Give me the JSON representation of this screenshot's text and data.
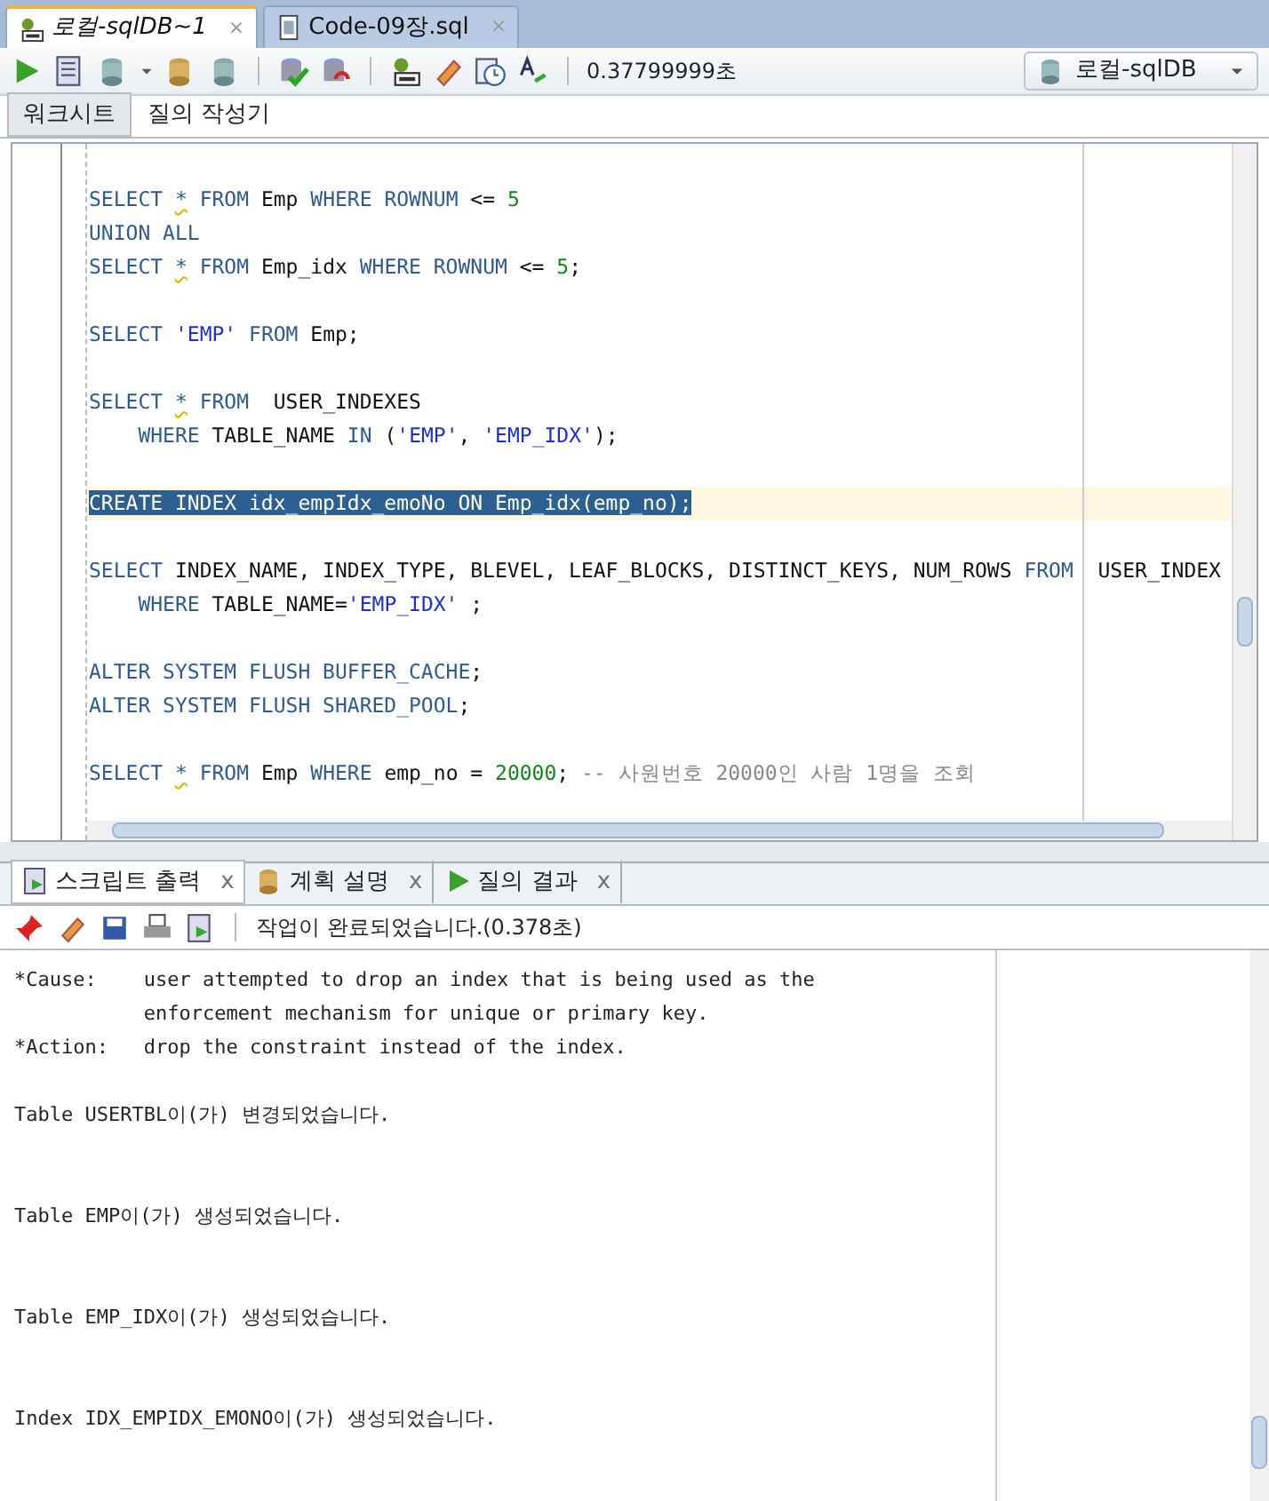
{
  "file_tabs": [
    {
      "label": "로컬-sqlDB~1",
      "close": "×",
      "selected": true
    },
    {
      "label": "Code-09장.sql",
      "close": "×",
      "selected": false
    }
  ],
  "toolbar": {
    "elapsed": "0.37799999초",
    "connection": "로컬-sqlDB"
  },
  "sub_tabs": [
    {
      "label": "워크시트",
      "selected": true
    },
    {
      "label": "질의 작성기",
      "selected": false
    }
  ],
  "editor_lines": [
    {
      "kind": "code",
      "selected": false,
      "tokens": [
        {
          "kind": "kw",
          "s": "SELECT "
        },
        {
          "kind": "warn",
          "s": "*"
        },
        {
          "kind": "kw",
          "s": " FROM "
        },
        {
          "kind": "id",
          "s": "Emp "
        },
        {
          "kind": "kw",
          "s": "WHERE ROWNUM "
        },
        {
          "kind": "id",
          "s": "<= "
        },
        {
          "kind": "num",
          "s": "5"
        }
      ]
    },
    {
      "kind": "code",
      "selected": false,
      "tokens": [
        {
          "kind": "kw",
          "s": "UNION ALL"
        }
      ]
    },
    {
      "kind": "code",
      "selected": false,
      "tokens": [
        {
          "kind": "kw",
          "s": "SELECT "
        },
        {
          "kind": "warn",
          "s": "*"
        },
        {
          "kind": "kw",
          "s": " FROM "
        },
        {
          "kind": "id",
          "s": "Emp_idx "
        },
        {
          "kind": "kw",
          "s": "WHERE ROWNUM "
        },
        {
          "kind": "id",
          "s": "<= "
        },
        {
          "kind": "num",
          "s": "5"
        },
        {
          "kind": "id",
          "s": ";"
        }
      ]
    },
    {
      "kind": "blank"
    },
    {
      "kind": "code",
      "selected": false,
      "tokens": [
        {
          "kind": "kw",
          "s": "SELECT "
        },
        {
          "kind": "str",
          "s": "'EMP'"
        },
        {
          "kind": "kw",
          "s": " FROM "
        },
        {
          "kind": "id",
          "s": "Emp;"
        }
      ]
    },
    {
      "kind": "blank"
    },
    {
      "kind": "code",
      "selected": false,
      "tokens": [
        {
          "kind": "kw",
          "s": "SELECT "
        },
        {
          "kind": "warn",
          "s": "*"
        },
        {
          "kind": "kw",
          "s": " FROM  "
        },
        {
          "kind": "id",
          "s": "USER_INDEXES"
        }
      ]
    },
    {
      "kind": "code",
      "selected": false,
      "tokens": [
        {
          "kind": "kw",
          "s": "    WHERE "
        },
        {
          "kind": "id",
          "s": "TABLE_NAME "
        },
        {
          "kind": "kw",
          "s": "IN "
        },
        {
          "kind": "id",
          "s": "("
        },
        {
          "kind": "str",
          "s": "'EMP'"
        },
        {
          "kind": "id",
          "s": ", "
        },
        {
          "kind": "str",
          "s": "'EMP_IDX'"
        },
        {
          "kind": "id",
          "s": ");"
        }
      ]
    },
    {
      "kind": "blank"
    },
    {
      "kind": "code",
      "selected": true,
      "tokens": [
        {
          "s": "CREATE INDEX idx_empIdx_emoNo ON Emp_idx(emp_no);"
        }
      ]
    },
    {
      "kind": "blank"
    },
    {
      "kind": "code",
      "selected": false,
      "tokens": [
        {
          "kind": "kw",
          "s": "SELECT "
        },
        {
          "kind": "id",
          "s": "INDEX_NAME, INDEX_TYPE, BLEVEL, LEAF_BLOCKS, DISTINCT_KEYS, NUM_ROWS "
        },
        {
          "kind": "kw",
          "s": "FROM  "
        },
        {
          "kind": "id",
          "s": "USER_INDEX"
        }
      ]
    },
    {
      "kind": "code",
      "selected": false,
      "tokens": [
        {
          "kind": "kw",
          "s": "    WHERE "
        },
        {
          "kind": "id",
          "s": "TABLE_NAME="
        },
        {
          "kind": "str",
          "s": "'EMP_IDX'"
        },
        {
          "kind": "id",
          "s": " ;"
        }
      ]
    },
    {
      "kind": "blank"
    },
    {
      "kind": "code",
      "selected": false,
      "tokens": [
        {
          "kind": "kw",
          "s": "ALTER SYSTEM FLUSH BUFFER_CACHE"
        },
        {
          "kind": "id",
          "s": ";"
        }
      ]
    },
    {
      "kind": "code",
      "selected": false,
      "tokens": [
        {
          "kind": "kw",
          "s": "ALTER SYSTEM FLUSH SHARED_POOL"
        },
        {
          "kind": "id",
          "s": ";"
        }
      ]
    },
    {
      "kind": "blank"
    },
    {
      "kind": "code",
      "selected": false,
      "tokens": [
        {
          "kind": "kw",
          "s": "SELECT "
        },
        {
          "kind": "warn",
          "s": "*"
        },
        {
          "kind": "kw",
          "s": " FROM "
        },
        {
          "kind": "id",
          "s": "Emp "
        },
        {
          "kind": "kw",
          "s": "WHERE "
        },
        {
          "kind": "id",
          "s": "emp_no = "
        },
        {
          "kind": "num",
          "s": "20000"
        },
        {
          "kind": "id",
          "s": "; "
        },
        {
          "kind": "cmt",
          "s": "-- 사원번호 20000인 사람 1명을 조회"
        }
      ]
    }
  ],
  "output_tabs": [
    {
      "label": "스크립트 출력",
      "close": "x",
      "selected": true
    },
    {
      "label": "계획 설명",
      "close": "x",
      "selected": false
    },
    {
      "label": "질의 결과",
      "close": "x",
      "selected": false
    }
  ],
  "output_status": "작업이 완료되었습니다.(0.378초)",
  "output_lines": [
    {
      "kind": "text",
      "s": "*Cause:    user attempted to drop an index that is being used as the"
    },
    {
      "kind": "text",
      "s": "           enforcement mechanism for unique or primary key."
    },
    {
      "kind": "text",
      "s": "*Action:   drop the constraint instead of the index."
    },
    {
      "kind": "blank"
    },
    {
      "kind": "text",
      "s": "Table USERTBL이(가) 변경되었습니다."
    },
    {
      "kind": "blank"
    },
    {
      "kind": "blank"
    },
    {
      "kind": "text",
      "s": "Table EMP이(가) 생성되었습니다."
    },
    {
      "kind": "blank"
    },
    {
      "kind": "blank"
    },
    {
      "kind": "text",
      "s": "Table EMP_IDX이(가) 생성되었습니다."
    },
    {
      "kind": "blank"
    },
    {
      "kind": "blank"
    },
    {
      "kind": "text",
      "s": "Index IDX_EMPIDX_EMONO이(가) 생성되었습니다."
    }
  ]
}
